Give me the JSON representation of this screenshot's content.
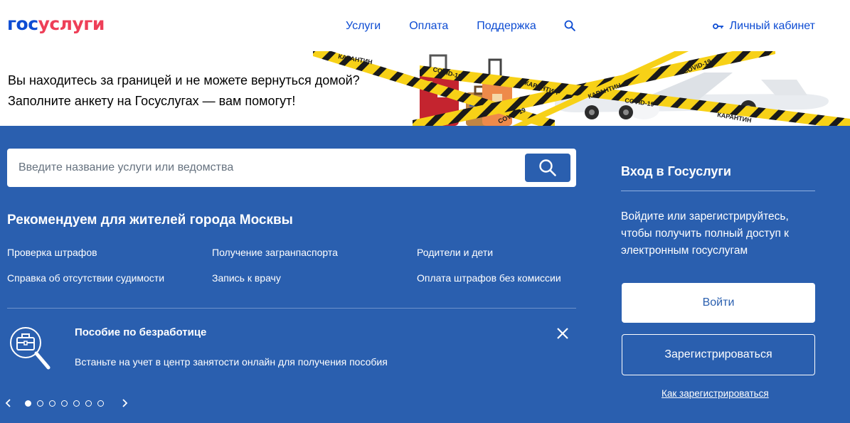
{
  "header": {
    "logo_part1": "гос",
    "logo_part2": "услуги",
    "nav": [
      "Услуги",
      "Оплата",
      "Поддержка"
    ],
    "cabinet_label": "Личный кабинет"
  },
  "banner": {
    "line1": "Вы находитесь за границей и не можете вернуться домой?",
    "line2": "Заполните анкету на Госуслугах — вам помогут!",
    "tape_labels": [
      "КАРАНТИН",
      "COVID-19",
      "КАРАНТИН",
      "COVID-19",
      "КАРАНТИН",
      "КАРАНТИН",
      "COVID-19",
      "COVID-19",
      "КАРАНТИН"
    ]
  },
  "search": {
    "placeholder": "Введите название услуги или ведомства"
  },
  "recommend": {
    "title": "Рекомендуем для жителей города Москвы",
    "links": [
      "Проверка штрафов",
      "Получение загранпаспорта",
      "Родители и дети",
      "Справка об отсутствии судимости",
      "Запись к врачу",
      "Оплата штрафов без комиссии"
    ]
  },
  "promo": {
    "title": "Пособие по безработице",
    "text": "Встаньте на учет в центр занятости онлайн для получения пособия",
    "slide_count": 7,
    "active_slide": 1
  },
  "login": {
    "title": "Вход в Госуслуги",
    "description": "Войдите или зарегистрируйтесь, чтобы получить полный доступ к электронным госуслугам",
    "login_button": "Войти",
    "register_button": "Зарегистрироваться",
    "how_register_link": "Как зарегистрироваться"
  },
  "colors": {
    "brand_blue": "#0d4cd3",
    "brand_red": "#ee3f58",
    "panel_blue": "#2a5faf",
    "tape_yellow": "#f7d117"
  },
  "icons": [
    "search-icon",
    "key-icon",
    "briefcase-search-icon",
    "close-icon",
    "chevron-left-icon",
    "chevron-right-icon"
  ]
}
